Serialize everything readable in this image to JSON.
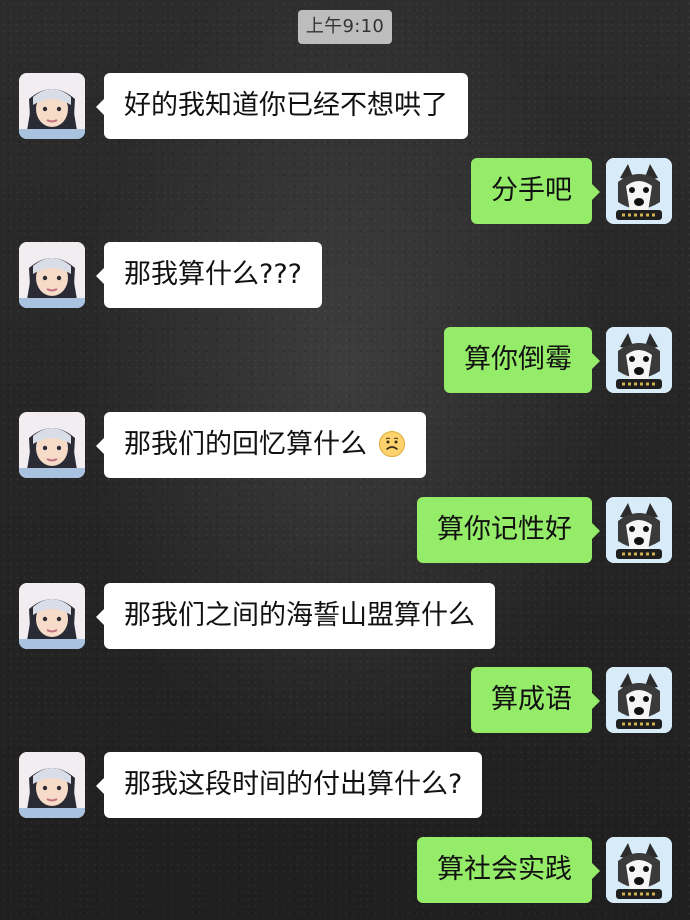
{
  "chat": {
    "timestamp": "上午9:10",
    "messages": [
      {
        "side": "left",
        "text": "好的我知道你已经不想哄了"
      },
      {
        "side": "right",
        "text": "分手吧"
      },
      {
        "side": "left",
        "text": "那我算什么???"
      },
      {
        "side": "right",
        "text": "算你倒霉"
      },
      {
        "side": "left",
        "text": "那我们的回忆算什么"
      },
      {
        "side": "right",
        "text": "算你记性好"
      },
      {
        "side": "left",
        "text": "那我们之间的海誓山盟算什么"
      },
      {
        "side": "right",
        "text": "算成语"
      },
      {
        "side": "left",
        "text": "那我这段时间的付出算什么?"
      },
      {
        "side": "right",
        "text": "算社会实践"
      }
    ]
  },
  "icons": {
    "girl_avatar": "girl-avatar",
    "dog_avatar": "husky-avatar",
    "sad_emoji": "sad-face-emoji"
  },
  "colors": {
    "left_bubble": "#ffffff",
    "right_bubble": "#95ec69",
    "timestamp_bg": "#bdbdbd"
  }
}
